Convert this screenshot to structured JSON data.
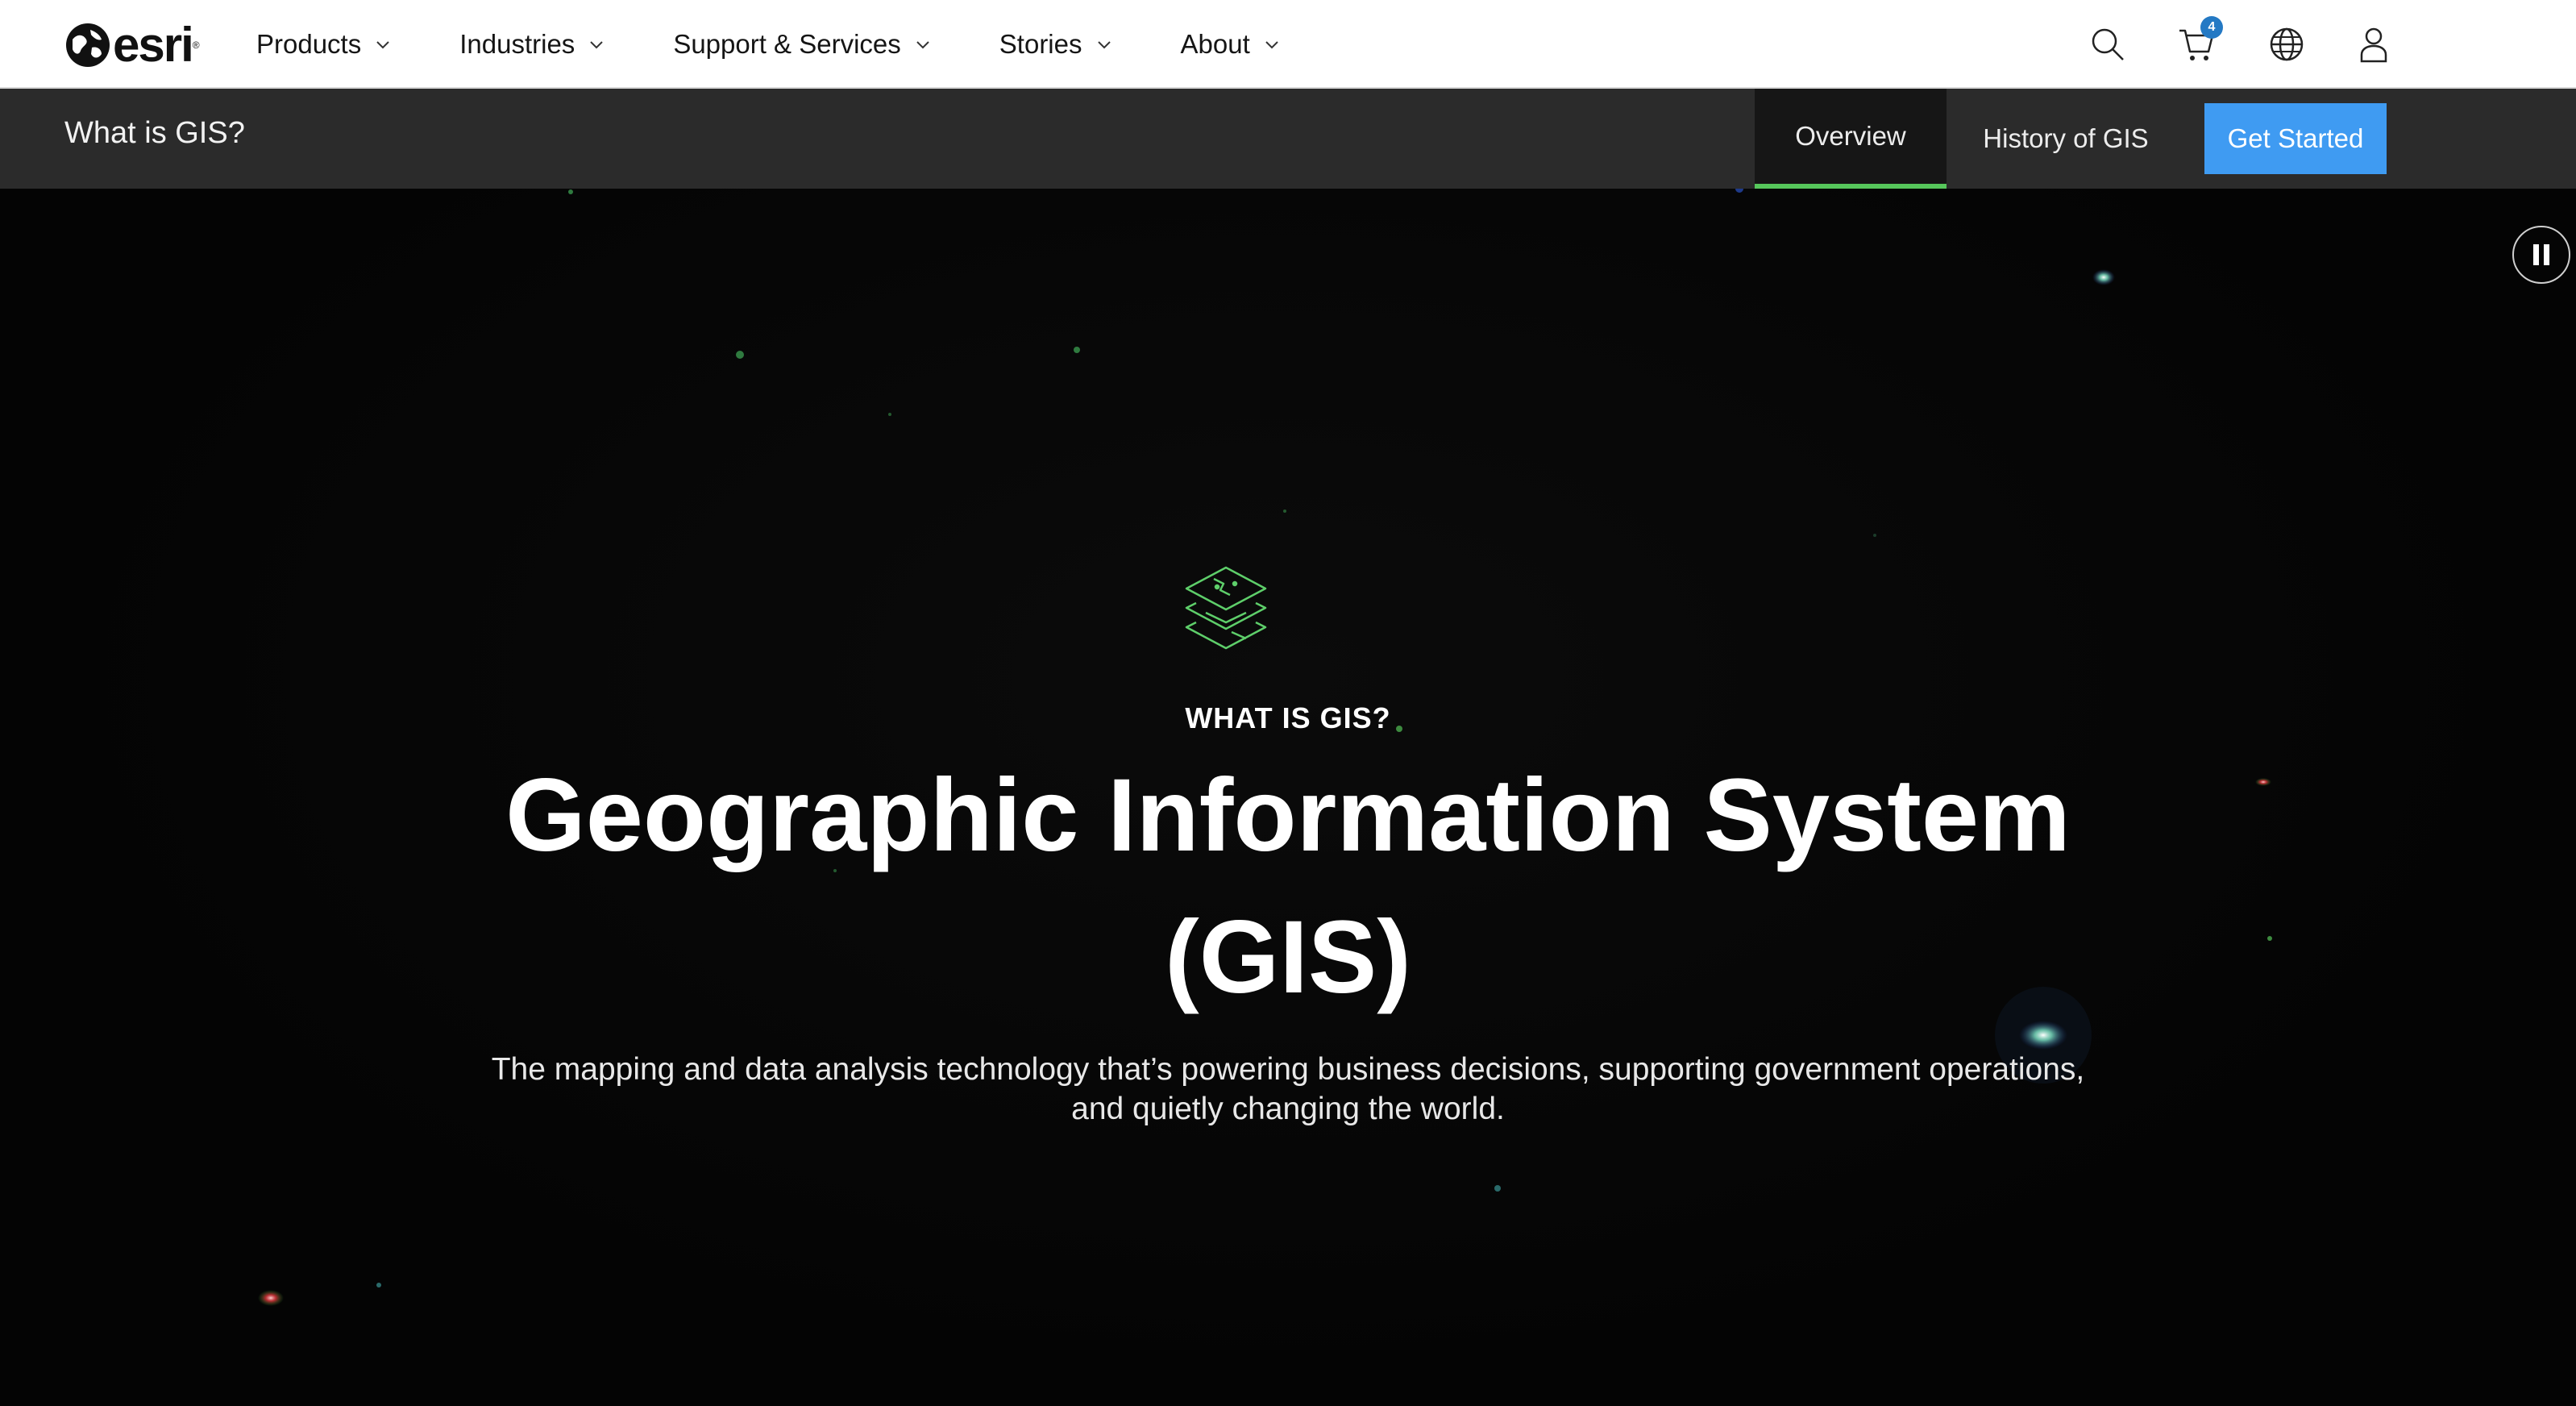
{
  "brand": {
    "name": "esri",
    "trademark": "®"
  },
  "nav": {
    "items": [
      {
        "label": "Products"
      },
      {
        "label": "Industries"
      },
      {
        "label": "Support & Services"
      },
      {
        "label": "Stories"
      },
      {
        "label": "About"
      }
    ],
    "icons": [
      "search-icon",
      "cart-icon",
      "globe-icon",
      "user-icon"
    ],
    "cart_count": "4"
  },
  "subnav": {
    "title": "What is GIS?",
    "tabs": [
      {
        "label": "Overview",
        "active": true
      },
      {
        "label": "History of GIS",
        "active": false
      }
    ],
    "cta_label": "Get Started"
  },
  "hero": {
    "eyebrow": "WHAT IS GIS?",
    "headline": "Geographic Information System (GIS)",
    "subtext": "The mapping and data analysis technology that’s powering business decisions, supporting government operations, and quietly changing the world.",
    "media_control": "pause-icon"
  },
  "colors": {
    "accent_green": "#56c75b",
    "cta_blue": "#3f9bf2",
    "badge_blue": "#2479c4",
    "subnav_bg": "#2b2b2b",
    "hero_bg": "#050505"
  }
}
